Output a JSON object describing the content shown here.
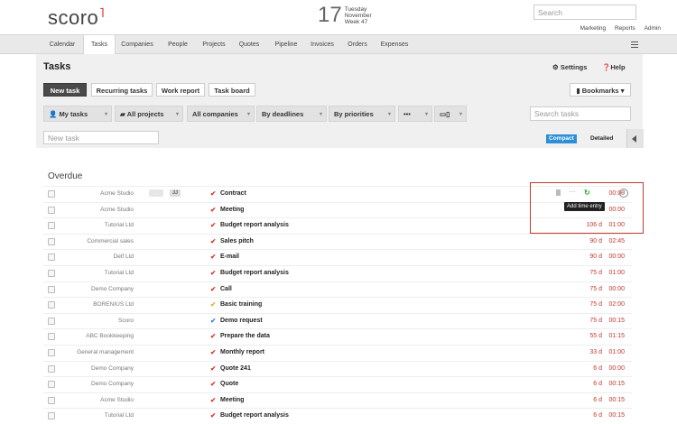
{
  "brand": "scoro",
  "date": {
    "day": "17",
    "weekday": "Tuesday",
    "month": "November",
    "week": "Week 47"
  },
  "search": {
    "placeholder": "Search"
  },
  "top_links": [
    "Marketing",
    "Reports",
    "Admin"
  ],
  "nav": [
    "Calendar",
    "Tasks",
    "Companies",
    "People",
    "Projects",
    "Quotes",
    "Pipeline",
    "Invoices",
    "Orders",
    "Expenses"
  ],
  "nav_active": "Tasks",
  "page": {
    "title": "Tasks",
    "settings": "Settings",
    "help": "Help"
  },
  "buttons": {
    "new_task": "New task",
    "recurring": "Recurring tasks",
    "work_report": "Work report",
    "task_board": "Task board",
    "bookmarks": "Bookmarks"
  },
  "filters": [
    "My tasks",
    "All projects",
    "All companies",
    "By deadlines",
    "By priorities",
    "•••",
    "▭▯"
  ],
  "search_tasks": {
    "placeholder": "Search tasks"
  },
  "new_task_field": {
    "placeholder": "New task"
  },
  "view": {
    "compact": "Compact",
    "detailed": "Detailed"
  },
  "section": "Overdue",
  "tooltip": "Add time entry",
  "first_row_tags": {
    "tag1": "...",
    "tag2": "JJ"
  },
  "tasks": [
    {
      "company": "Acme Studio",
      "name": "Contract",
      "days": "",
      "time": "00:00",
      "check_color": "#d33"
    },
    {
      "company": "Acme Studio",
      "name": "Meeting",
      "days": "",
      "time": "00:00",
      "check_color": "#d33"
    },
    {
      "company": "Tutorial Ltd",
      "name": "Budget report analysis",
      "days": "106 d",
      "time": "01:00",
      "check_color": "#d33"
    },
    {
      "company": "Commercial sales",
      "name": "Sales pitch",
      "days": "90 d",
      "time": "02:45",
      "check_color": "#d33"
    },
    {
      "company": "Delf Ltd",
      "name": "E-mail",
      "days": "90 d",
      "time": "00:00",
      "check_color": "#d33"
    },
    {
      "company": "Tutorial Ltd",
      "name": "Budget report analysis",
      "days": "75 d",
      "time": "01:00",
      "check_color": "#d33"
    },
    {
      "company": "Demo Company",
      "name": "Call",
      "days": "75 d",
      "time": "00:00",
      "check_color": "#d33"
    },
    {
      "company": "BORENIUS Ltd",
      "name": "Basic training",
      "days": "75 d",
      "time": "02:00",
      "check_color": "#e8b020"
    },
    {
      "company": "Scoro",
      "name": "Demo request",
      "days": "75 d",
      "time": "00:15",
      "check_color": "#3a7fd0"
    },
    {
      "company": "ABC Bookkeeping",
      "name": "Prepare the data",
      "days": "55 d",
      "time": "01:15",
      "check_color": "#d33"
    },
    {
      "company": "General management",
      "name": "Monthly report",
      "days": "33 d",
      "time": "01:00",
      "check_color": "#d33"
    },
    {
      "company": "Demo Company",
      "name": "Quote 241",
      "days": "6 d",
      "time": "00:00",
      "check_color": "#d33"
    },
    {
      "company": "Demo Company",
      "name": "Quote",
      "days": "6 d",
      "time": "00:15",
      "check_color": "#d33"
    },
    {
      "company": "Acme Studio",
      "name": "Meeting",
      "days": "6 d",
      "time": "00:15",
      "check_color": "#d33"
    },
    {
      "company": "Tutorial Ltd",
      "name": "Budget report analysis",
      "days": "6 d",
      "time": "00:15",
      "check_color": "#d33"
    }
  ]
}
